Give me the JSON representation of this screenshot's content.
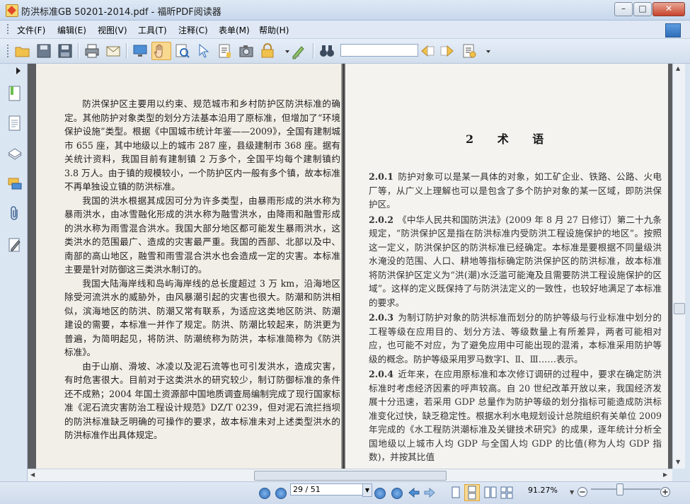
{
  "window": {
    "title": "防洪标准GB 50201-2014.pdf - 福昕PDF阅读器",
    "minimize": "–",
    "maximize": "□",
    "close": "✕"
  },
  "menu": [
    "文件(F)",
    "编辑(E)",
    "视图(V)",
    "工具(T)",
    "注释(C)",
    "表单(M)",
    "帮助(H)"
  ],
  "toolbar": {
    "search_value": ""
  },
  "left_page": {
    "paragraphs": [
      "防洪保护区主要用以约束、规范城市和乡村防护区防洪标准的确定。其他防护对象类型的划分方法基本沿用了原标准，但增加了“环境保护设施”类型。根据《中国城市统计年鉴——2009》，全国有建制城市 655 座，其中地级以上的城市 287 座，县级建制市 368 座。据有关统计资料，我国目前有建制镇 2 万多个，全国平均每个建制镇约 3.8 万人。由于镇的规模较小，一个防护区内一般有多个镇，故本标准不再单独设立镇的防洪标准。",
      "我国的洪水根据其成因可分为许多类型，由暴雨形成的洪水称为暴雨洪水，由冰雪融化形成的洪水称为融雪洪水，由降雨和融雪形成的洪水称为雨雪混合洪水。我国大部分地区都可能发生暴雨洪水，这类洪水的范围最广、造成的灾害最严重。我国的西部、北部以及中、南部的高山地区，融雪和雨雪混合洪水也会造成一定的灾害。本标准主要是针对防御这三类洪水制订的。",
      "我国大陆海岸线和岛屿海岸线的总长度超过 3 万 km，沿海地区除受河流洪水的威胁外，由风暴潮引起的灾害也很大。防潮和防洪相似，滨海地区的防洪、防潮又常有联系，为适应这类地区防洪、防潮建设的需要，本标准一并作了规定。防洪、防潮比较起来，防洪更为普遍，为简明起见，将防洪、防潮统称为防洪，本标准简称为《防洪标准》。",
      "由于山崩、滑坡、冰凌以及泥石流等也可引发洪水，造成灾害，有时危害很大。目前对于这类洪水的研究较少，制订防御标准的条件还不成熟；2004 年国土资源部中国地质调查局编制完成了现行国家标准《泥石流灾害防治工程设计规范》DZ/T 0239，但对泥石流拦挡坝的防洪标准缺乏明确的可操作的要求，故本标准未对上述类型洪水的防洪标准作出具体规定。"
    ]
  },
  "right_page": {
    "heading": "2 术 语",
    "items": [
      {
        "num": "2.0.1",
        "text": "防护对象可以是某一具体的对象，如工矿企业、铁路、公路、火电厂等，从广义上理解也可以是包含了多个防护对象的某一区域，即防洪保护区。"
      },
      {
        "num": "2.0.2",
        "text": "《中华人民共和国防洪法》(2009 年 8 月 27 日修订）第二十九条规定，“防洪保护区是指在防洪标准内受防洪工程设施保护的地区”。按照这一定义，防洪保护区的防洪标准已经确定。本标准是要根据不同量级洪水淹没的范围、人口、耕地等指标确定防洪保护区的防洪标准，故本标准将防洪保护区定义为“洪(潮)水泛滥可能淹及且需要防洪工程设施保护的区域”。这样的定义既保持了与防洪法定义的一致性，也较好地满足了本标准的要求。"
      },
      {
        "num": "2.0.3",
        "text": "为制订防护对象的防洪标准而划分的防护等级与行业标准中划分的工程等级在应用目的、划分方法、等级数量上有所差异，两者可能相对应，也可能不对应，为了避免应用中可能出现的混淆，本标准采用防护等级的概念。防护等级采用罗马数字Ⅰ、Ⅱ、Ⅲ……表示。"
      },
      {
        "num": "2.0.4",
        "text": "近年来，在应用原标准和本次修订调研的过程中，要求在确定防洪标准时考虑经济因素的呼声较高。自 20 世纪改革开放以来，我国经济发展十分迅速，若采用 GDP 总量作为防护等级的划分指标可能造成防洪标准变化过快，缺乏稳定性。根据水利水电规划设计总院组织有关单位 2009 年完成的《水工程防洪潮标准及关键技术研究》的成果，逐年统计分析全国地级以上城市人均 GDP 与全国人均 GDP 的比值(称为人均 GDP 指数)，并按其比值"
      }
    ]
  },
  "status": {
    "page_display": "29 / 51",
    "zoom": "91.27%"
  },
  "colors": {
    "titlebar": "#c7d7ec",
    "workspace": "#5b5d61",
    "page_left": "#f2efe8",
    "page_right": "#f4f3ef"
  }
}
